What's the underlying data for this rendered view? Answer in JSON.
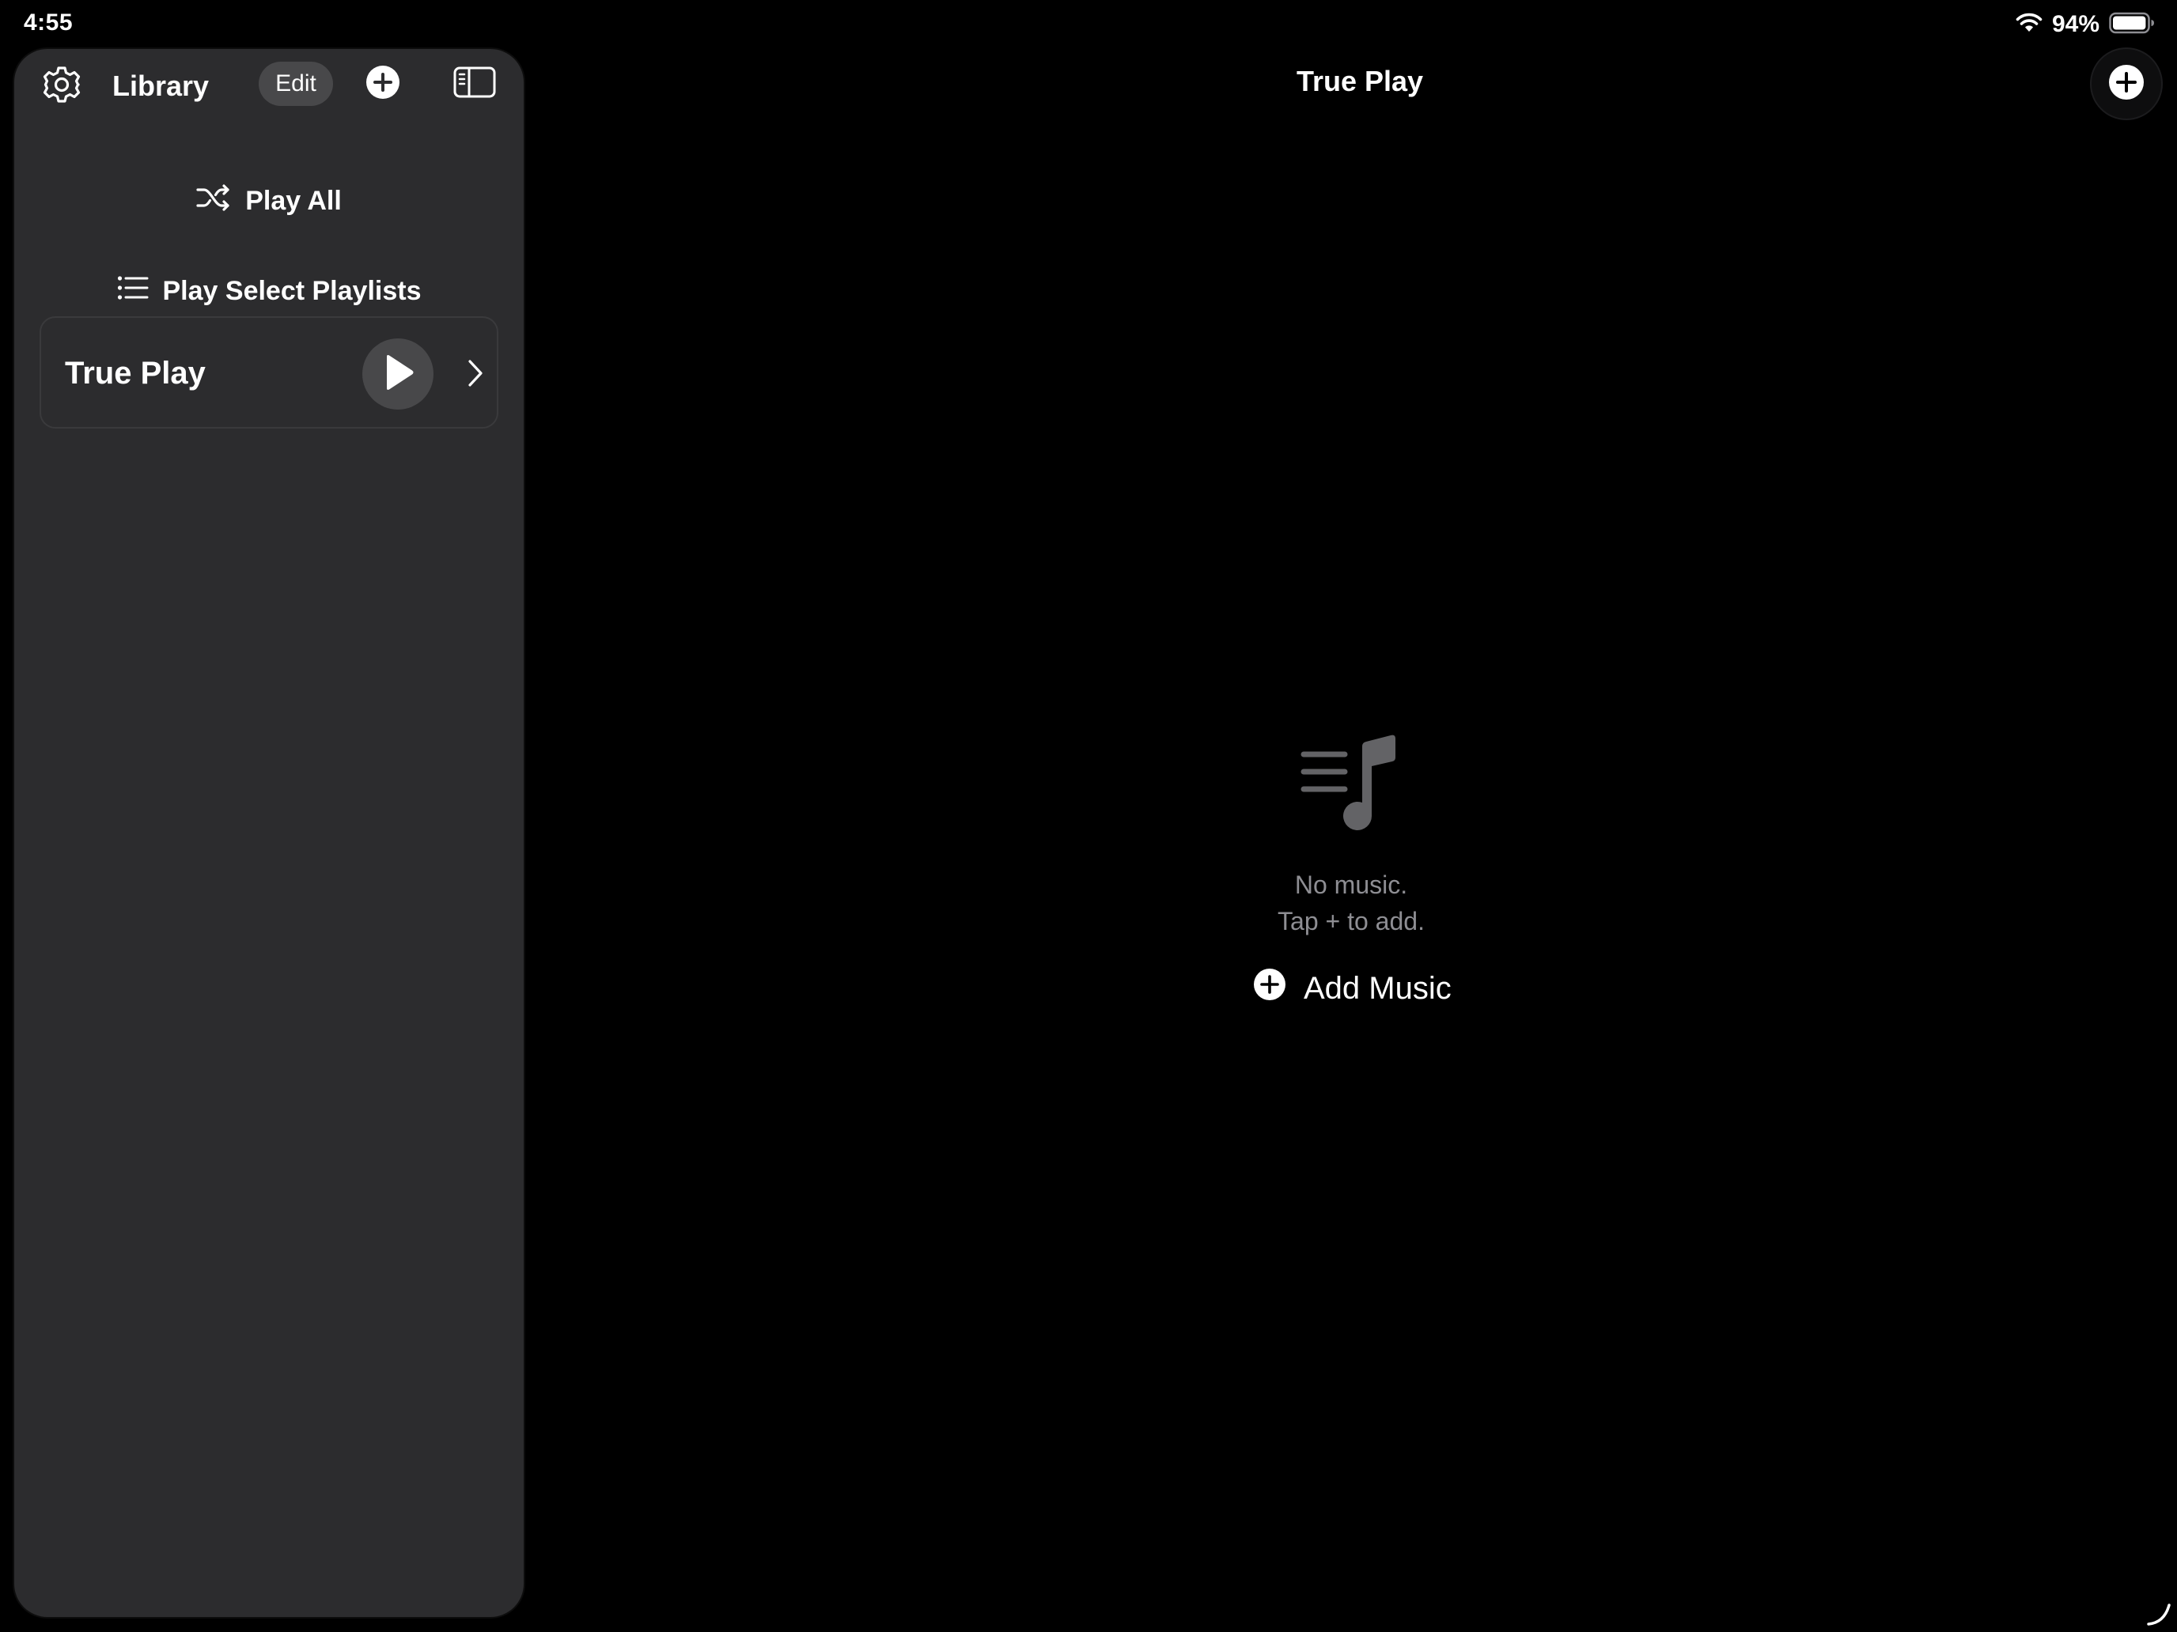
{
  "status_bar": {
    "time": "4:55",
    "battery_percent": "94%",
    "battery_level": 0.94,
    "icons": [
      "wifi-icon",
      "battery-icon"
    ]
  },
  "sidebar": {
    "title": "Library",
    "edit_label": "Edit",
    "icons": [
      "gear-icon",
      "plus-circle-icon",
      "sidebar-toggle-icon"
    ],
    "actions": [
      {
        "label": "Play All",
        "icon": "shuffle-icon"
      },
      {
        "label": "Play Select Playlists",
        "icon": "list-icon"
      }
    ],
    "playlists": [
      {
        "name": "True Play"
      }
    ]
  },
  "main": {
    "title": "True Play",
    "empty_state": {
      "icon": "music-list-icon",
      "line1": "No music.",
      "line2": "Tap + to add.",
      "add_label": "Add Music"
    }
  },
  "colors": {
    "background": "#000000",
    "sidebar": "#2c2c2e",
    "secondary_text": "#8e8e93",
    "button_fill": "#48484a"
  }
}
